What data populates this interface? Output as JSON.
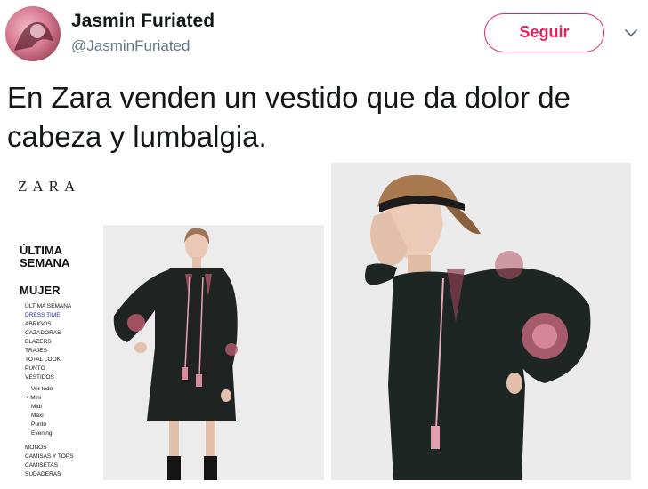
{
  "tweet": {
    "author_name": "Jasmin Furiated",
    "author_handle": "@JasminFuriated",
    "follow_label": "Seguir",
    "text": "En Zara venden un vestido que da dolor de cabeza y lumbalgia."
  },
  "zara_page": {
    "logo": "ZARA",
    "promo_title": "ÚLTIMA SEMANA",
    "section_title": "MUJER",
    "nav_items": [
      "ÚLTIMA SEMANA",
      "DRESS TIME",
      "ABRIGOS",
      "CAZADORAS",
      "BLAZERS",
      "TRAJES",
      "TOTAL LOOK",
      "PUNTO",
      "VESTIDOS",
      "Ver todo",
      "Mini",
      "Midi",
      "Maxi",
      "Punto",
      "Evening",
      "MONOS",
      "CAMISAS Y TOPS",
      "CAMISETAS",
      "SUDADERAS"
    ]
  },
  "icons": {
    "dropdown": "chevron-down-icon",
    "avatar": "avatar-image"
  },
  "colors": {
    "follow_accent": "#e0245e",
    "handle_gray": "#657786",
    "nav_active": "#2a2aa8"
  }
}
